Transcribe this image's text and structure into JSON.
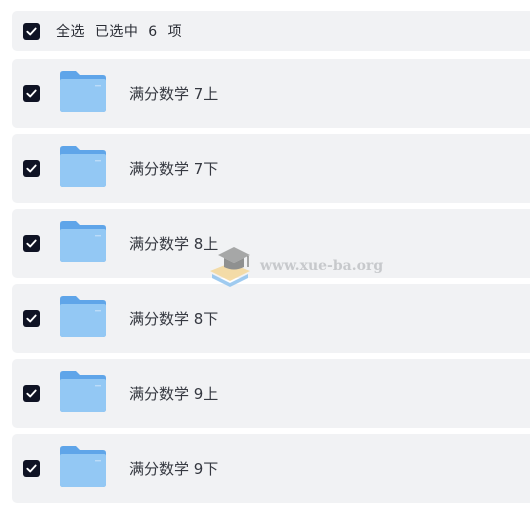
{
  "header": {
    "select_all_text": "全选  已选中  6  项"
  },
  "items": [
    {
      "label": "满分数学 7上"
    },
    {
      "label": "满分数学 7下"
    },
    {
      "label": "满分数学 8上"
    },
    {
      "label": "满分数学 8下"
    },
    {
      "label": "满分数学 9上"
    },
    {
      "label": "满分数学 9下"
    }
  ],
  "watermark": {
    "text": "www.xue-ba.org"
  },
  "colors": {
    "checkbox": "#0f1324",
    "row_bg": "#f1f2f4",
    "folder": "#7db8f0"
  }
}
